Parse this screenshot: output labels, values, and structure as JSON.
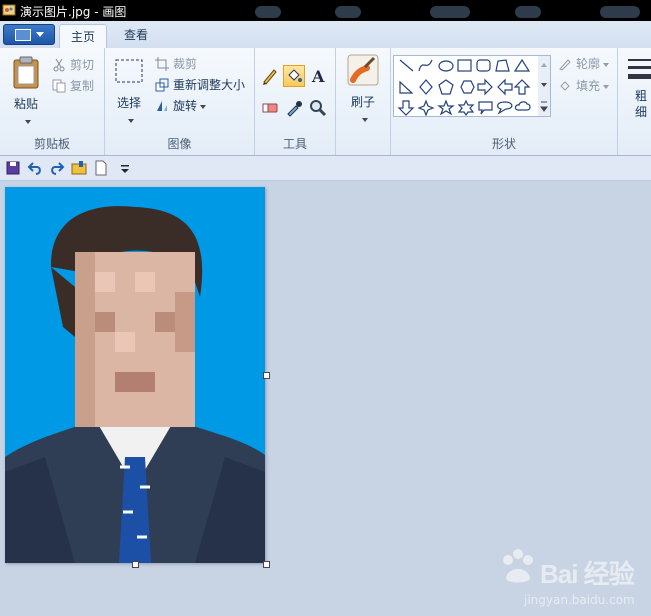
{
  "window": {
    "title": "演示图片.jpg - 画图"
  },
  "tabs": {
    "home": "主页",
    "view": "查看"
  },
  "clipboard": {
    "paste": "粘贴",
    "cut": "剪切",
    "copy": "复制",
    "label": "剪贴板"
  },
  "image": {
    "select": "选择",
    "crop": "裁剪",
    "resize": "重新调整大小",
    "rotate": "旋转",
    "label": "图像"
  },
  "tools": {
    "label": "工具",
    "selected": "fill-icon"
  },
  "brushes": {
    "label": "刷子"
  },
  "shapes": {
    "outline": "轮廓",
    "fill": "填充",
    "label": "形状"
  },
  "size": {
    "label": "粗细"
  },
  "watermark": {
    "brand": "Bai 经验",
    "url": "jingyan.baidu.com"
  },
  "colors": {
    "ribbon_bg": "#f5f9fd",
    "photo_bg": "#0099e6",
    "canvas_bg": "#c8d3e4",
    "selected_tool": "#f9c95a"
  }
}
